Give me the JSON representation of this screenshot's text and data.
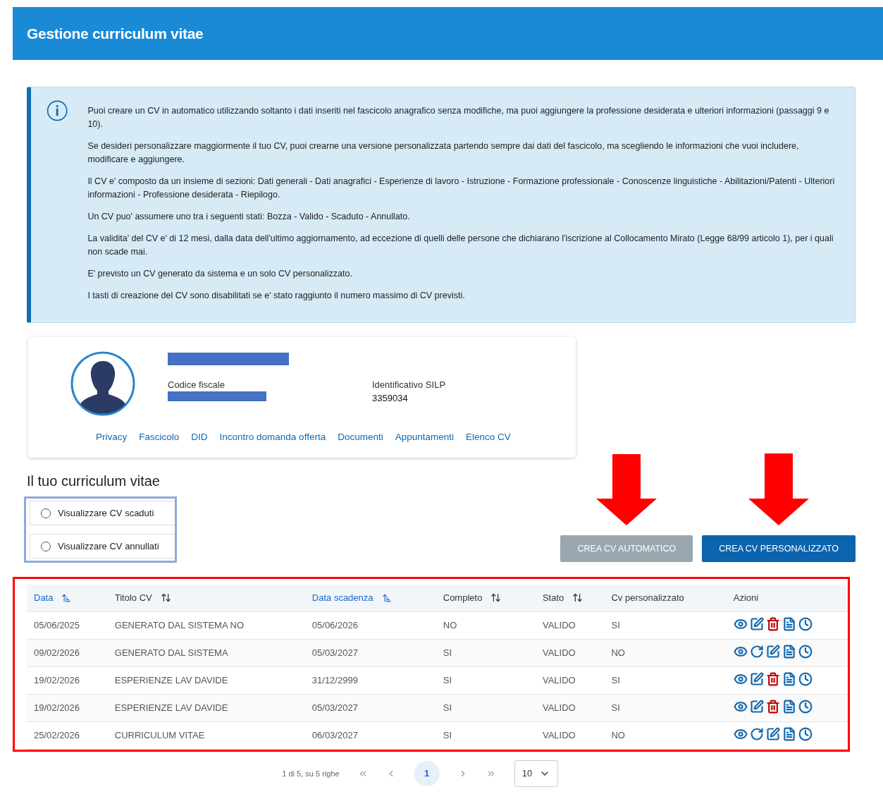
{
  "header": {
    "title": "Gestione curriculum vitae"
  },
  "info": {
    "paragraphs": [
      "Puoi creare un CV in automatico utilizzando soltanto i dati inseriti nel fascicolo anagrafico senza modifiche, ma puoi aggiungere la professione desiderata e ulteriori informazioni (passaggi 9 e 10).",
      "Se desideri personalizzare maggiormente il tuo CV, puoi crearne una versione personalizzata partendo sempre dai dati del fascicolo, ma scegliendo le informazioni che vuoi includere, modificare e aggiungere.",
      "Il CV e' composto da un insieme di sezioni: Dati generali - Dati anagrafici - Esperienze di lavoro - Istruzione - Formazione professionale - Conoscenze linguistiche - Abilitazioni/Patenti - Ulteriori informazioni - Professione desiderata - Riepilogo.",
      "Un CV puo' assumere uno tra i seguenti stati: Bozza - Valido - Scaduto - Annullato.",
      "La validita' del CV e' di 12 mesi, dalla data dell'ultimo aggiornamento, ad eccezione di quelli delle persone che dichiarano l'iscrizione al Collocamento Mirato (Legge 68/99 articolo 1), per i quali non scade mai.",
      "E' previsto un CV generato da sistema e un solo CV personalizzato.",
      "I tasti di creazione del CV sono disabilitati se e' stato raggiunto il numero massimo di CV previsti."
    ]
  },
  "profile": {
    "fields": [
      {
        "label": "Codice fiscale",
        "redacted": true
      },
      {
        "label": "Identificativo SILP",
        "value": "3359034"
      }
    ],
    "links": [
      "Privacy",
      "Fascicolo",
      "DID",
      "Incontro domanda offerta",
      "Documenti",
      "Appuntamenti",
      "Elenco CV"
    ]
  },
  "section_title": "Il tuo curriculum vitae",
  "filters": [
    {
      "label": "Visualizzare CV scaduti",
      "selected": false
    },
    {
      "label": "Visualizzare CV annullati",
      "selected": false
    }
  ],
  "buttons": [
    {
      "label": "CREA CV AUTOMATICO",
      "disabled": true
    },
    {
      "label": "CREA CV PERSONALIZZATO",
      "disabled": false
    }
  ],
  "table": {
    "columns": [
      {
        "label": "Data",
        "sortable": true,
        "sorted": true
      },
      {
        "label": "Titolo CV",
        "sortable": true,
        "sorted": false
      },
      {
        "label": "Data scadenza",
        "sortable": true,
        "sorted": true
      },
      {
        "label": "Completo",
        "sortable": true,
        "sorted": false
      },
      {
        "label": "Stato",
        "sortable": true,
        "sorted": false
      },
      {
        "label": "Cv personalizzato",
        "sortable": false,
        "sorted": false
      },
      {
        "label": "Azioni",
        "sortable": false,
        "sorted": false
      }
    ],
    "rows": [
      {
        "cells": [
          "05/06/2025",
          "GENERATO DAL SISTEMA NO",
          "05/06/2026",
          "NO",
          "VALIDO",
          "SI"
        ],
        "actions": [
          {
            "kind": "view"
          },
          {
            "kind": "edit"
          },
          {
            "kind": "delete"
          },
          {
            "kind": "pdf"
          },
          {
            "kind": "history"
          }
        ]
      },
      {
        "cells": [
          "09/02/2026",
          "GENERATO DAL SISTEMA",
          "05/03/2027",
          "SI",
          "VALIDO",
          "NO"
        ],
        "actions": [
          {
            "kind": "view"
          },
          {
            "kind": "refresh"
          },
          {
            "kind": "edit"
          },
          {
            "kind": "pdf"
          },
          {
            "kind": "history"
          }
        ]
      },
      {
        "cells": [
          "19/02/2026",
          "ESPERIENZE LAV DAVIDE",
          "31/12/2999",
          "SI",
          "VALIDO",
          "SI"
        ],
        "actions": [
          {
            "kind": "view"
          },
          {
            "kind": "edit"
          },
          {
            "kind": "delete"
          },
          {
            "kind": "pdf"
          },
          {
            "kind": "history"
          }
        ]
      },
      {
        "cells": [
          "19/02/2026",
          "ESPERIENZE LAV DAVIDE",
          "05/03/2027",
          "SI",
          "VALIDO",
          "SI"
        ],
        "actions": [
          {
            "kind": "view"
          },
          {
            "kind": "edit"
          },
          {
            "kind": "delete"
          },
          {
            "kind": "pdf"
          },
          {
            "kind": "history"
          }
        ]
      },
      {
        "cells": [
          "25/02/2026",
          "CURRICULUM VITAE",
          "06/03/2027",
          "SI",
          "VALIDO",
          "NO"
        ],
        "actions": [
          {
            "kind": "view"
          },
          {
            "kind": "refresh"
          },
          {
            "kind": "edit"
          },
          {
            "kind": "pdf"
          },
          {
            "kind": "history"
          }
        ]
      }
    ]
  },
  "pagination": {
    "summary": "1 di 5, su 5 righe",
    "pages": [
      {
        "label": "1",
        "selected": true
      }
    ],
    "page_size": "10"
  }
}
